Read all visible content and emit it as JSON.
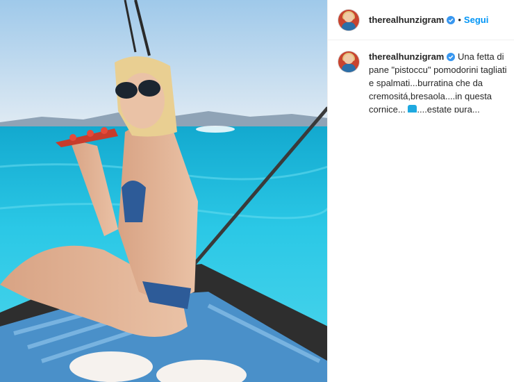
{
  "post": {
    "username": "therealhunzigram",
    "follow_label": "Segui",
    "separator": "•",
    "caption_part1": " Una fetta di pane \"pistoccu\" pomodorini tagliati e spalmati...burratina che da cremositá,bresaola....in questa cornice... ",
    "caption_part2": "....estate pura..."
  },
  "icons": {
    "verified": "verified-badge-icon",
    "caption_emoji": "water-wave-emoji-icon"
  },
  "colors": {
    "follow": "#0095f6",
    "verified": "#3897f0",
    "sea": "#1fc2e4",
    "sky": "#cfe3f3"
  }
}
